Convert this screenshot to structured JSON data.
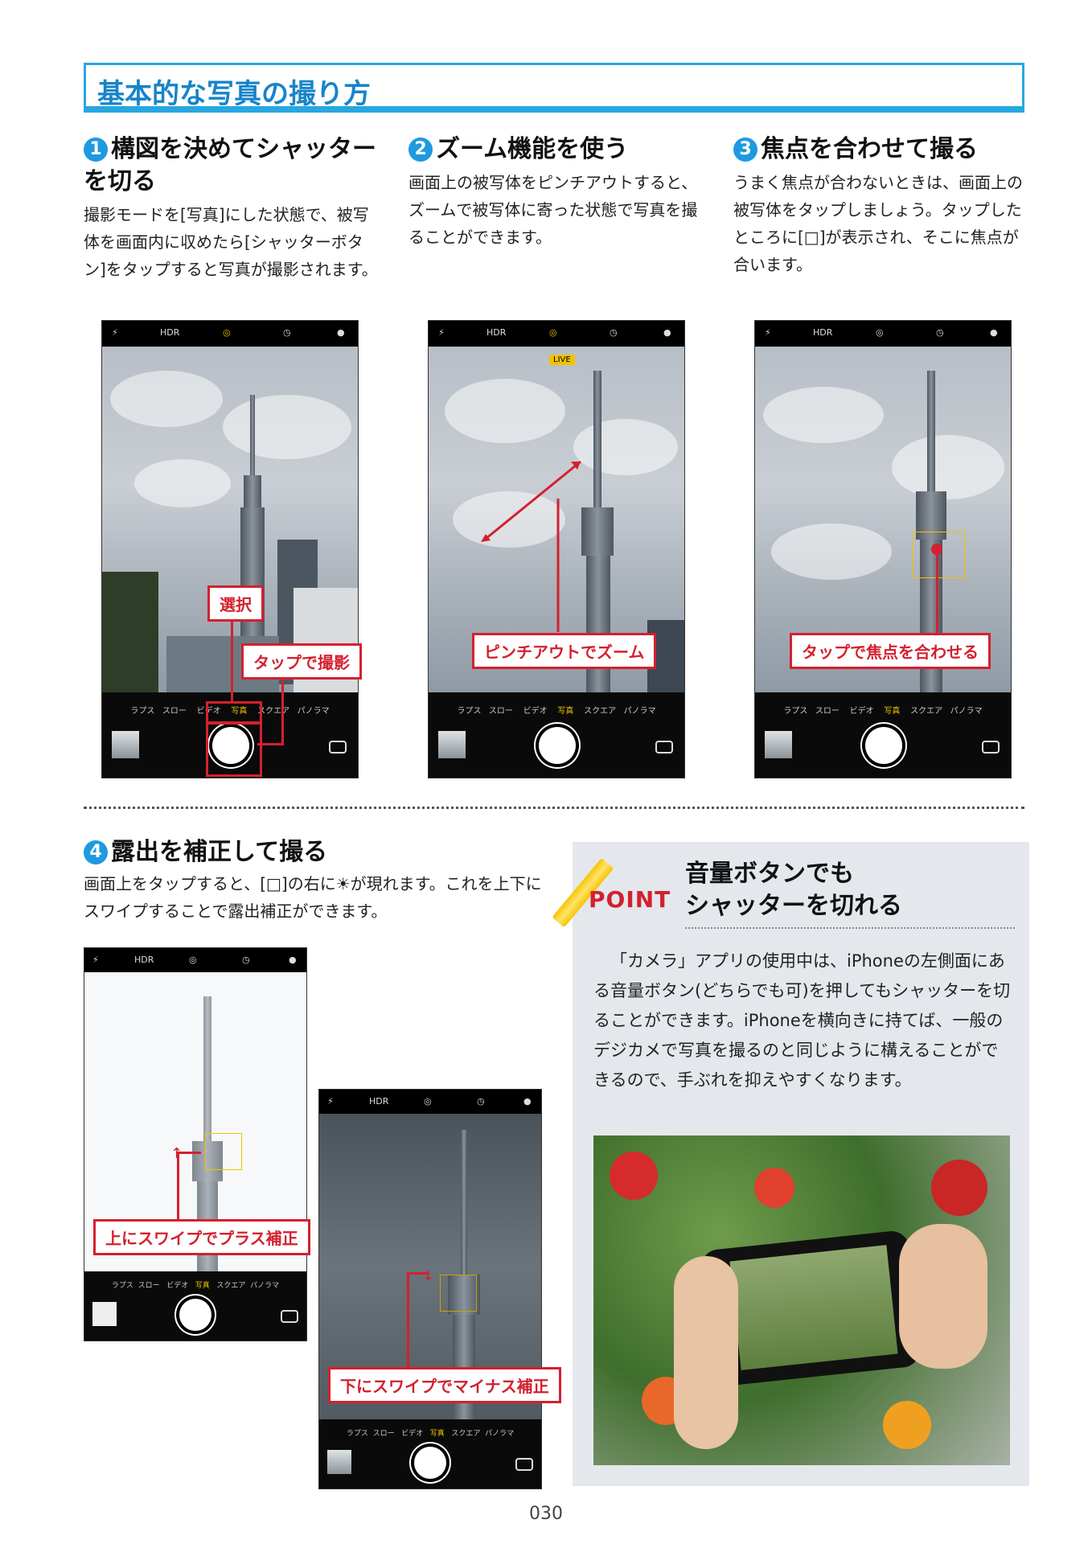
{
  "title": "基本的な写真の撮り方",
  "steps": [
    {
      "num": "1",
      "heading": "構図を決めてシャッターを切る",
      "body": "撮影モードを[写真]にした状態で、被写体を画面内に収めたら[シャッターボタン]をタップすると写真が撮影されます。"
    },
    {
      "num": "2",
      "heading": "ズーム機能を使う",
      "body": "画面上の被写体をピンチアウトすると、ズームで被写体に寄った状態で写真を撮ることができます。"
    },
    {
      "num": "3",
      "heading": "焦点を合わせて撮る",
      "body": "うまく焦点が合わないときは、画面上の被写体をタップしましょう。タップしたところに[□]が表示され、そこに焦点が合います。"
    },
    {
      "num": "4",
      "heading": "露出を補正して撮る",
      "body": "画面上をタップすると、[□]の右に☀が現れます。これを上下にスワイプすることで露出補正ができます。"
    }
  ],
  "camera": {
    "top_hdr": "HDR",
    "live_badge": "LIVE",
    "modes": [
      "ラプス",
      "スロー",
      "ビデオ",
      "写真",
      "スクエア",
      "パノラマ"
    ],
    "selected_mode": "写真"
  },
  "callouts": {
    "select": "選択",
    "tap_shoot": "タップで撮影",
    "pinch": "ピンチアウトでズーム",
    "focus": "タップで焦点を合わせる",
    "swipe_up": "上にスワイプでプラス補正",
    "swipe_down": "下にスワイプでマイナス補正"
  },
  "point": {
    "label": "POINT",
    "title_line1": "音量ボタンでも",
    "title_line2": "シャッターを切れる",
    "body": "「カメラ」アプリの使用中は、iPhoneの左側面にある音量ボタン(どちらでも可)を押してもシャッターを切ることができます。iPhoneを横向きに持てば、一般のデジカメで写真を撮るのと同じように構えることができるので、手ぶれを抑えやすくなります。"
  },
  "page_number": "030",
  "colors": {
    "accent_blue": "#27a7e2",
    "callout_red": "#d4202f",
    "ios_yellow": "#f2c200"
  }
}
